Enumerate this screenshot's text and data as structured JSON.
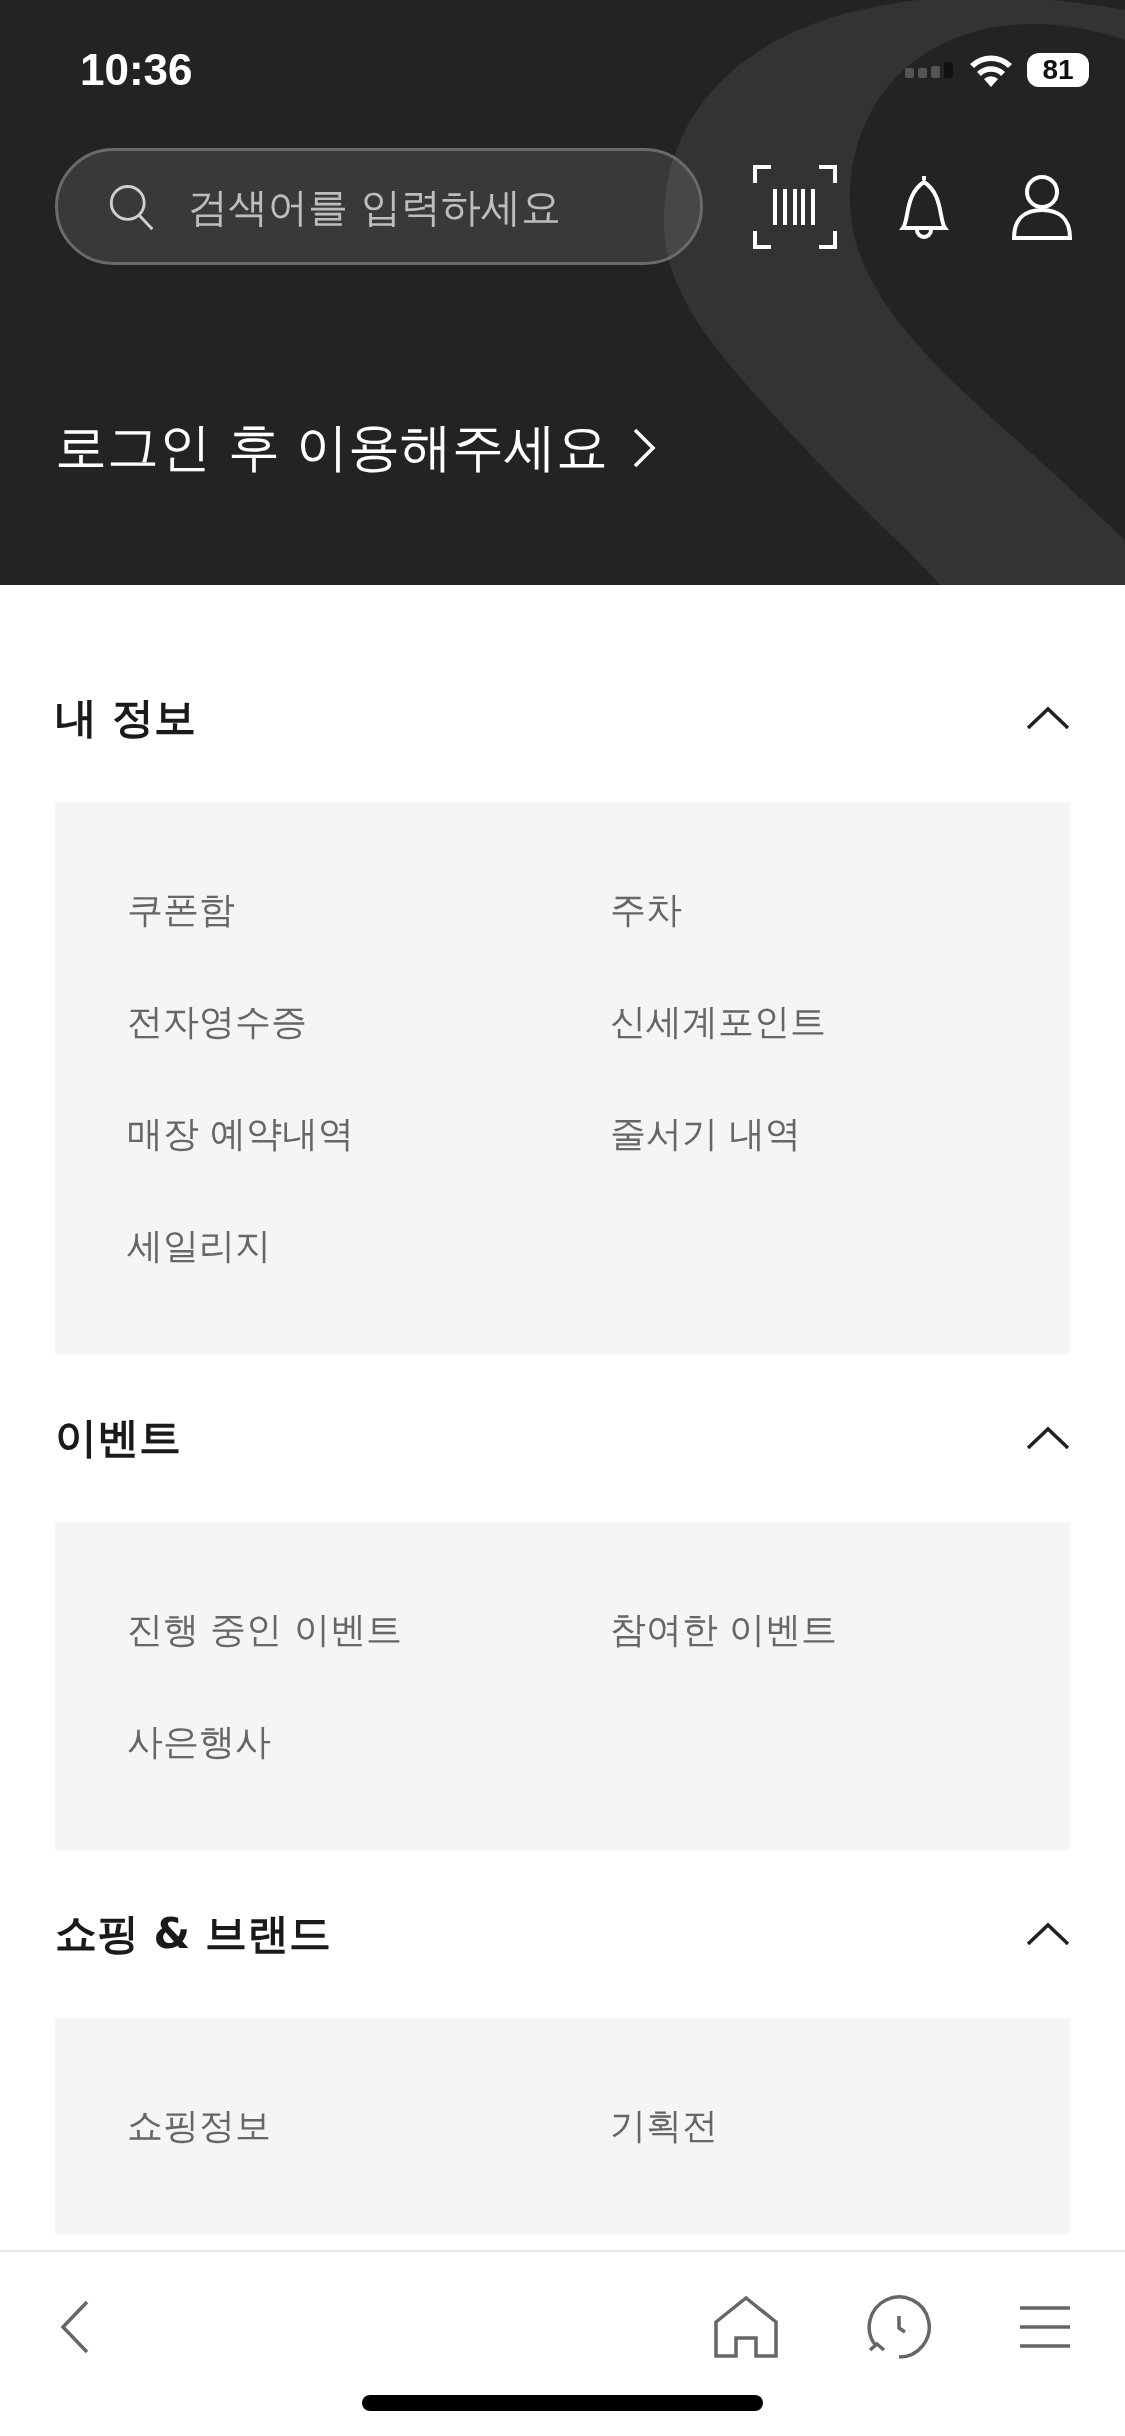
{
  "status_bar": {
    "time": "10:36",
    "battery": "81"
  },
  "search": {
    "placeholder": "검색어를 입력하세요"
  },
  "login_prompt": "로그인 후 이용해주세요",
  "sections": [
    {
      "title": "내 정보",
      "expanded": true,
      "items": [
        "쿠폰함",
        "주차",
        "전자영수증",
        "신세계포인트",
        "매장 예약내역",
        "줄서기 내역",
        "세일리지"
      ]
    },
    {
      "title": "이벤트",
      "expanded": true,
      "items": [
        "진행 중인 이벤트",
        "참여한 이벤트",
        "사은행사"
      ]
    },
    {
      "title": "쇼핑 & 브랜드",
      "expanded": true,
      "items": [
        "쇼핑정보",
        "기획전"
      ]
    }
  ]
}
